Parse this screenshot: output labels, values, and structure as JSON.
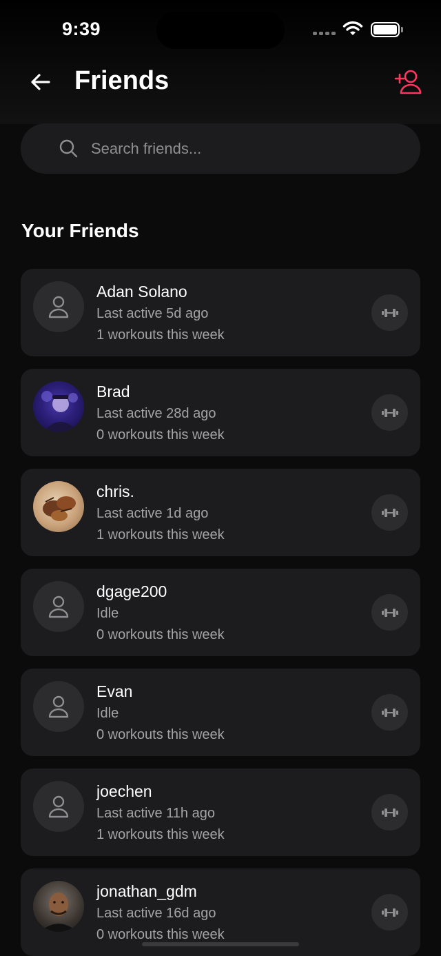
{
  "status_bar": {
    "time": "9:39"
  },
  "header": {
    "title": "Friends"
  },
  "search": {
    "placeholder": "Search friends..."
  },
  "section": {
    "title": "Your Friends"
  },
  "friends": [
    {
      "name": "Adan Solano",
      "status": "Last active 5d ago",
      "workouts": "1 workouts this week",
      "avatar": "placeholder-person-icon"
    },
    {
      "name": "Brad",
      "status": "Last active 28d ago",
      "workouts": "0 workouts this week",
      "avatar": "photo-purple"
    },
    {
      "name": "chris.",
      "status": "Last active 1d ago",
      "workouts": "1 workouts this week",
      "avatar": "photo-food"
    },
    {
      "name": "dgage200",
      "status": "Idle",
      "workouts": "0 workouts this week",
      "avatar": "placeholder-person-icon"
    },
    {
      "name": "Evan",
      "status": "Idle",
      "workouts": "0 workouts this week",
      "avatar": "placeholder-person-icon"
    },
    {
      "name": "joechen",
      "status": "Last active 11h ago",
      "workouts": "1 workouts this week",
      "avatar": "placeholder-person-icon"
    },
    {
      "name": "jonathan_gdm",
      "status": "Last active 16d ago",
      "workouts": "0 workouts this week",
      "avatar": "photo-portrait"
    }
  ],
  "colors": {
    "accent": "#ff375f",
    "background": "#0b0b0b",
    "card": "#1c1c1e",
    "secondary_text": "#a4a4a8"
  }
}
